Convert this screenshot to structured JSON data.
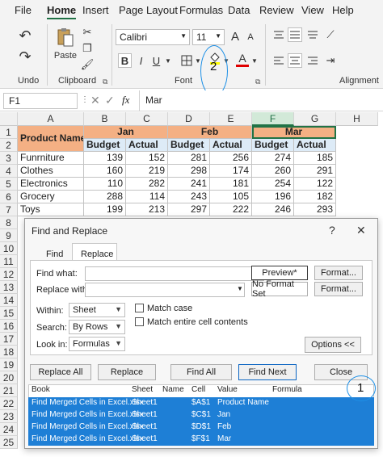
{
  "menu": [
    "File",
    "Home",
    "Insert",
    "Page Layout",
    "Formulas",
    "Data",
    "Review",
    "View",
    "Help"
  ],
  "ribbon": {
    "undo_label": "Undo",
    "clipboard_label": "Clipboard",
    "paste_label": "Paste",
    "font_name": "Calibri",
    "font_size": "11",
    "font_label": "Font",
    "alignment_label": "Alignment",
    "bold": "B",
    "italic": "I",
    "underline": "U",
    "grow": "A",
    "shrink": "A",
    "fontcolor": "A",
    "annotation_2": "2"
  },
  "formula_bar": {
    "name_box": "F1",
    "fx": "fx",
    "value": "Mar"
  },
  "columns": [
    "A",
    "B",
    "C",
    "D",
    "E",
    "F",
    "G",
    "H"
  ],
  "rows": [
    "1",
    "2",
    "3",
    "4",
    "5",
    "6",
    "7",
    "8",
    "9",
    "10",
    "11",
    "12",
    "13",
    "14",
    "15",
    "16",
    "17",
    "18",
    "19",
    "20",
    "21",
    "22",
    "23",
    "24",
    "25"
  ],
  "sheet": {
    "product_header": "Product Name",
    "months": [
      "Jan",
      "Feb",
      "Mar"
    ],
    "sub_headers": [
      "Budget",
      "Actual",
      "Budget",
      "Actual",
      "Budget",
      "Actual"
    ],
    "data": [
      {
        "name": "Funrniture",
        "values": [
          "139",
          "152",
          "281",
          "256",
          "274",
          "185"
        ]
      },
      {
        "name": "Clothes",
        "values": [
          "160",
          "219",
          "298",
          "174",
          "260",
          "291"
        ]
      },
      {
        "name": "Electronics",
        "values": [
          "110",
          "282",
          "241",
          "181",
          "254",
          "122"
        ]
      },
      {
        "name": "Grocery",
        "values": [
          "288",
          "114",
          "243",
          "105",
          "196",
          "182"
        ]
      },
      {
        "name": "Toys",
        "values": [
          "199",
          "213",
          "297",
          "222",
          "246",
          "293"
        ]
      }
    ]
  },
  "dialog": {
    "title": "Find and Replace",
    "help": "?",
    "close_x": "✕",
    "tab_find": "Find",
    "tab_replace": "Replace",
    "find_what_label": "Find what:",
    "replace_with_label": "Replace with:",
    "preview_button": "Preview*",
    "no_format_button": "No Format Set",
    "format_button_1": "Format...",
    "format_button_2": "Format...",
    "within_label": "Within:",
    "within_value": "Sheet",
    "search_label": "Search:",
    "search_value": "By Rows",
    "lookin_label": "Look in:",
    "lookin_value": "Formulas",
    "match_case": "Match case",
    "match_entire": "Match entire cell contents",
    "options_button": "Options <<",
    "replace_all": "Replace All",
    "replace": "Replace",
    "find_all": "Find All",
    "find_next": "Find Next",
    "close": "Close",
    "annotation_1": "1",
    "results_headers": [
      "Book",
      "Sheet",
      "Name",
      "Cell",
      "Value",
      "Formula"
    ],
    "results": [
      {
        "book": "Find Merged Cells in Excel.xlsx",
        "sheet": "Sheet1",
        "name": "",
        "cell": "$A$1",
        "value": "Product Name",
        "formula": ""
      },
      {
        "book": "Find Merged Cells in Excel.xlsx",
        "sheet": "Sheet1",
        "name": "",
        "cell": "$C$1",
        "value": "Jan",
        "formula": ""
      },
      {
        "book": "Find Merged Cells in Excel.xlsx",
        "sheet": "Sheet1",
        "name": "",
        "cell": "$D$1",
        "value": "Feb",
        "formula": ""
      },
      {
        "book": "Find Merged Cells in Excel.xlsx",
        "sheet": "Sheet1",
        "name": "",
        "cell": "$F$1",
        "value": "Mar",
        "formula": ""
      }
    ]
  }
}
